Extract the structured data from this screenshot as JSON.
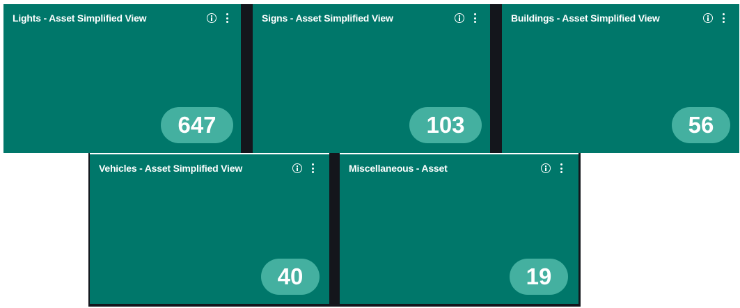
{
  "tiles": [
    {
      "title": "Lights - Asset Simplified View",
      "count": "647",
      "info_icon": "info-circle-icon",
      "menu_icon": "more-vertical-icon"
    },
    {
      "title": "Signs - Asset Simplified View",
      "count": "103",
      "info_icon": "info-circle-icon",
      "menu_icon": "more-vertical-icon"
    },
    {
      "title": "Buildings - Asset Simplified View",
      "count": "56",
      "info_icon": "info-circle-icon",
      "menu_icon": "more-vertical-icon"
    },
    {
      "title": "Vehicles - Asset Simplified View",
      "count": "40",
      "info_icon": "info-circle-icon",
      "menu_icon": "more-vertical-icon"
    },
    {
      "title": "Miscellaneous - Asset",
      "count": "19",
      "info_icon": "info-circle-icon",
      "menu_icon": "more-vertical-icon"
    }
  ],
  "colors": {
    "tile_background": "#00776a",
    "badge_background": "#44b0a0",
    "text": "#ffffff",
    "divider": "#14161c",
    "page_background": "#ffffff"
  }
}
